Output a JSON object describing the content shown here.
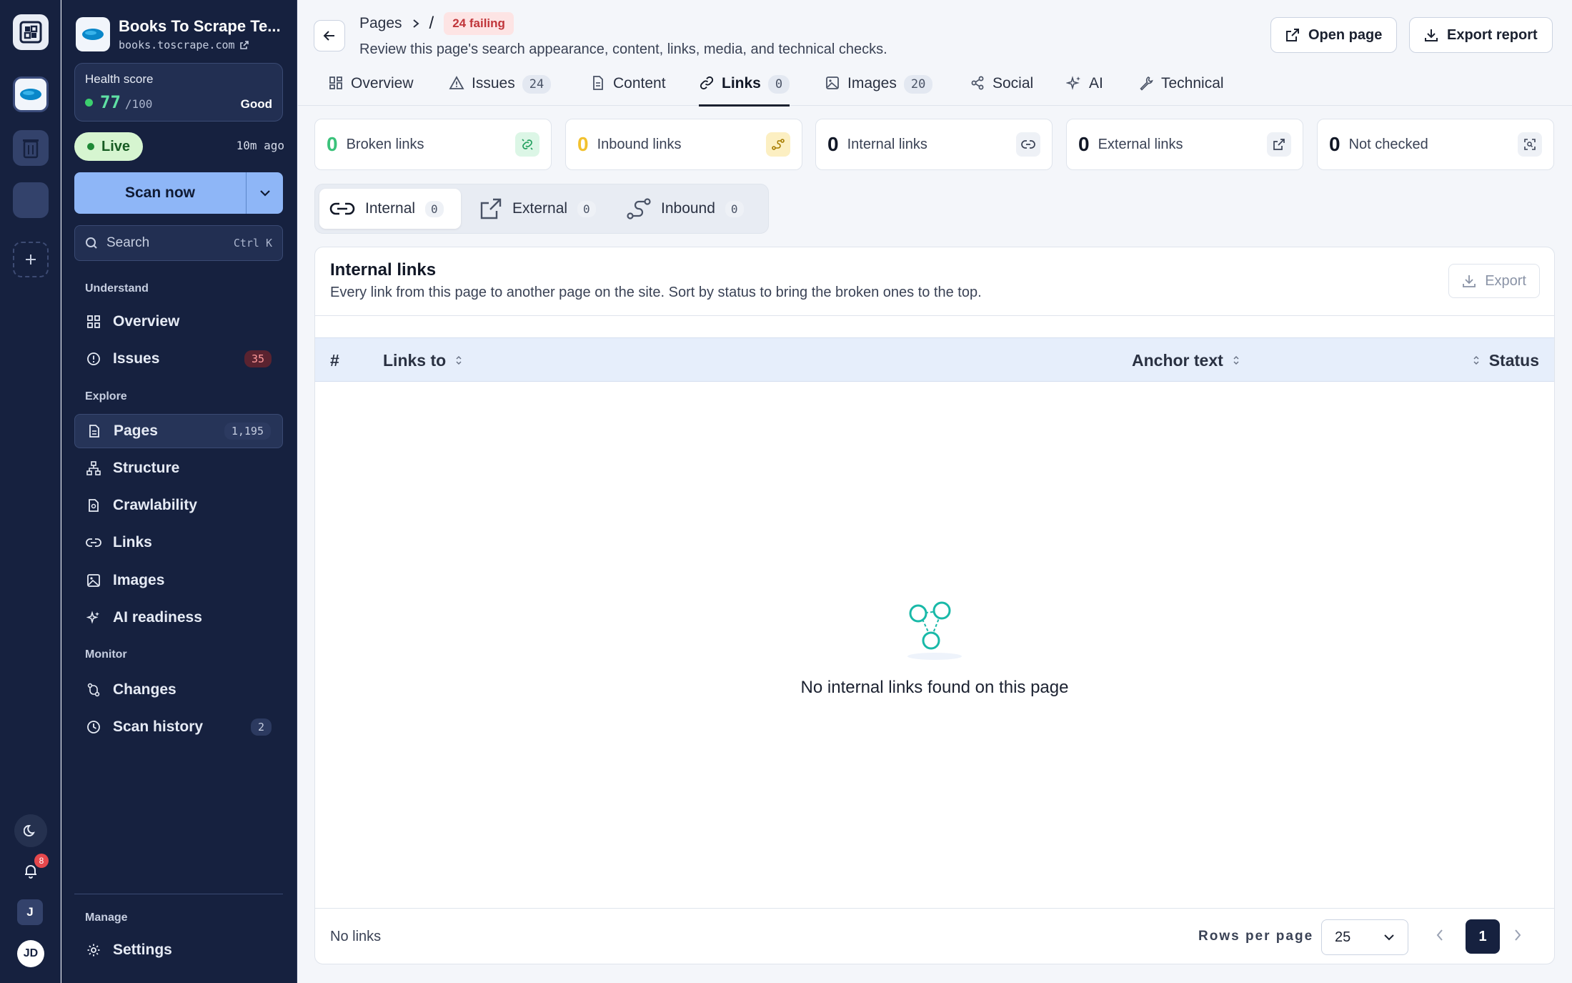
{
  "colors": {
    "sidebar_bg": "#16213f",
    "accent": "#8eb6f7",
    "good": "#5fe0a4",
    "danger": "#c0353a",
    "teal": "#19b9a8"
  },
  "rail": {
    "notifications_count": "8",
    "workspace_initial": "J",
    "user_initials": "JD"
  },
  "site": {
    "name": "Books To Scrape Te...",
    "url": "books.toscrape.com"
  },
  "health": {
    "label": "Health score",
    "score": "77",
    "max": "/100",
    "grade": "Good"
  },
  "status": {
    "live_label": "Live",
    "last_scan": "10m ago"
  },
  "scan": {
    "label": "Scan now"
  },
  "search": {
    "placeholder": "Search",
    "shortcut": "Ctrl K"
  },
  "nav": {
    "sections": {
      "understand": "Understand",
      "explore": "Explore",
      "monitor": "Monitor",
      "manage": "Manage"
    },
    "overview": "Overview",
    "issues": {
      "label": "Issues",
      "count": "35"
    },
    "pages": {
      "label": "Pages",
      "count": "1,195"
    },
    "structure": "Structure",
    "crawlability": "Crawlability",
    "links": "Links",
    "images": "Images",
    "ai_readiness": "AI readiness",
    "changes": "Changes",
    "scan_history": {
      "label": "Scan history",
      "count": "2"
    },
    "settings": "Settings"
  },
  "header": {
    "breadcrumb_root": "Pages",
    "breadcrumb_slash": "/",
    "failing_badge": "24 failing",
    "description": "Review this page's search appearance, content, links, media, and technical checks.",
    "open_page": "Open page",
    "export_report": "Export report"
  },
  "tabs": {
    "overview": "Overview",
    "issues": {
      "label": "Issues",
      "count": "24"
    },
    "content": "Content",
    "links": {
      "label": "Links",
      "count": "0"
    },
    "images": {
      "label": "Images",
      "count": "20"
    },
    "social": "Social",
    "ai": "AI",
    "technical": "Technical"
  },
  "stats": [
    {
      "value": "0",
      "label": "Broken links"
    },
    {
      "value": "0",
      "label": "Inbound links"
    },
    {
      "value": "0",
      "label": "Internal links"
    },
    {
      "value": "0",
      "label": "External links"
    },
    {
      "value": "0",
      "label": "Not checked"
    }
  ],
  "link_types": [
    {
      "label": "Internal",
      "count": "0"
    },
    {
      "label": "External",
      "count": "0"
    },
    {
      "label": "Inbound",
      "count": "0"
    }
  ],
  "table": {
    "title": "Internal links",
    "description": "Every link from this page to another page on the site. Sort by status to bring the broken ones to the top.",
    "export_label": "Export",
    "columns": {
      "index": "#",
      "links_to": "Links to",
      "anchor_text": "Anchor text",
      "status": "Status"
    },
    "empty_message": "No internal links found on this page",
    "footer_summary": "No links",
    "rows_per_page_label": "Rows per page",
    "rows_per_page": "25",
    "current_page": "1"
  }
}
